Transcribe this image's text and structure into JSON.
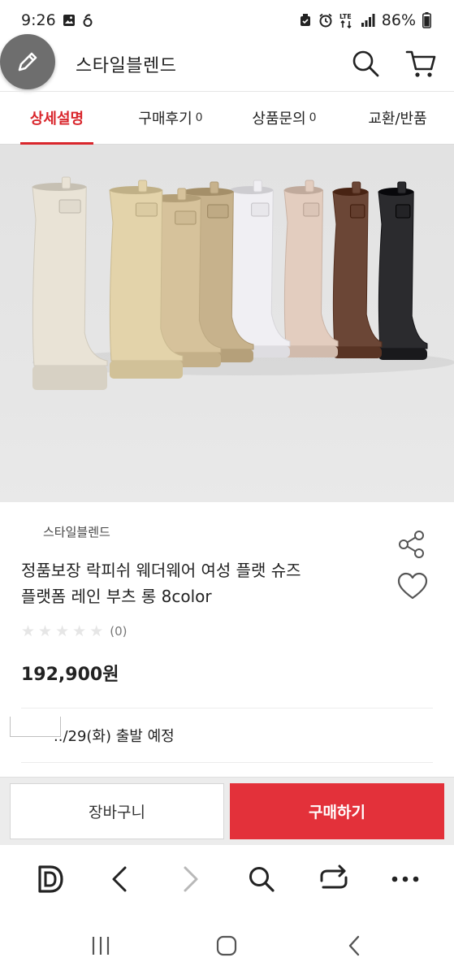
{
  "status_bar": {
    "time": "9:26",
    "battery": "86%",
    "network": "LTE"
  },
  "header": {
    "title": "스타일블렌드",
    "icons": [
      "pencil-icon",
      "search-icon",
      "cart-icon"
    ]
  },
  "tabs": [
    {
      "label": "상세설명",
      "count": "",
      "active": true
    },
    {
      "label": "구매후기",
      "count": "0",
      "active": false
    },
    {
      "label": "상품문의",
      "count": "0",
      "active": false
    },
    {
      "label": "교환/반품",
      "count": "",
      "active": false
    }
  ],
  "product": {
    "brand": "스타일블렌드",
    "title_line1": "정품보장 락피쉬 웨더웨어 여성 플랫 슈즈",
    "title_line2": "플랫폼 레인 부츠 롱 8color",
    "stars": [
      "★",
      "★",
      "★",
      "★",
      "★"
    ],
    "rating_count": "(0)",
    "price": "192,900원",
    "shipping": "../29(화) 출발 예정",
    "boot_colors": [
      "#e9e3d6",
      "#e3d3aa",
      "#d6c29b",
      "#c7b28c",
      "#f0eff3",
      "#e3cdbf",
      "#6b4636",
      "#2b2b2e"
    ]
  },
  "actions": {
    "cart_label": "장바구니",
    "buy_label": "구매하기"
  },
  "colors": {
    "accent": "#d9262c",
    "buy_button": "#e3313a"
  }
}
